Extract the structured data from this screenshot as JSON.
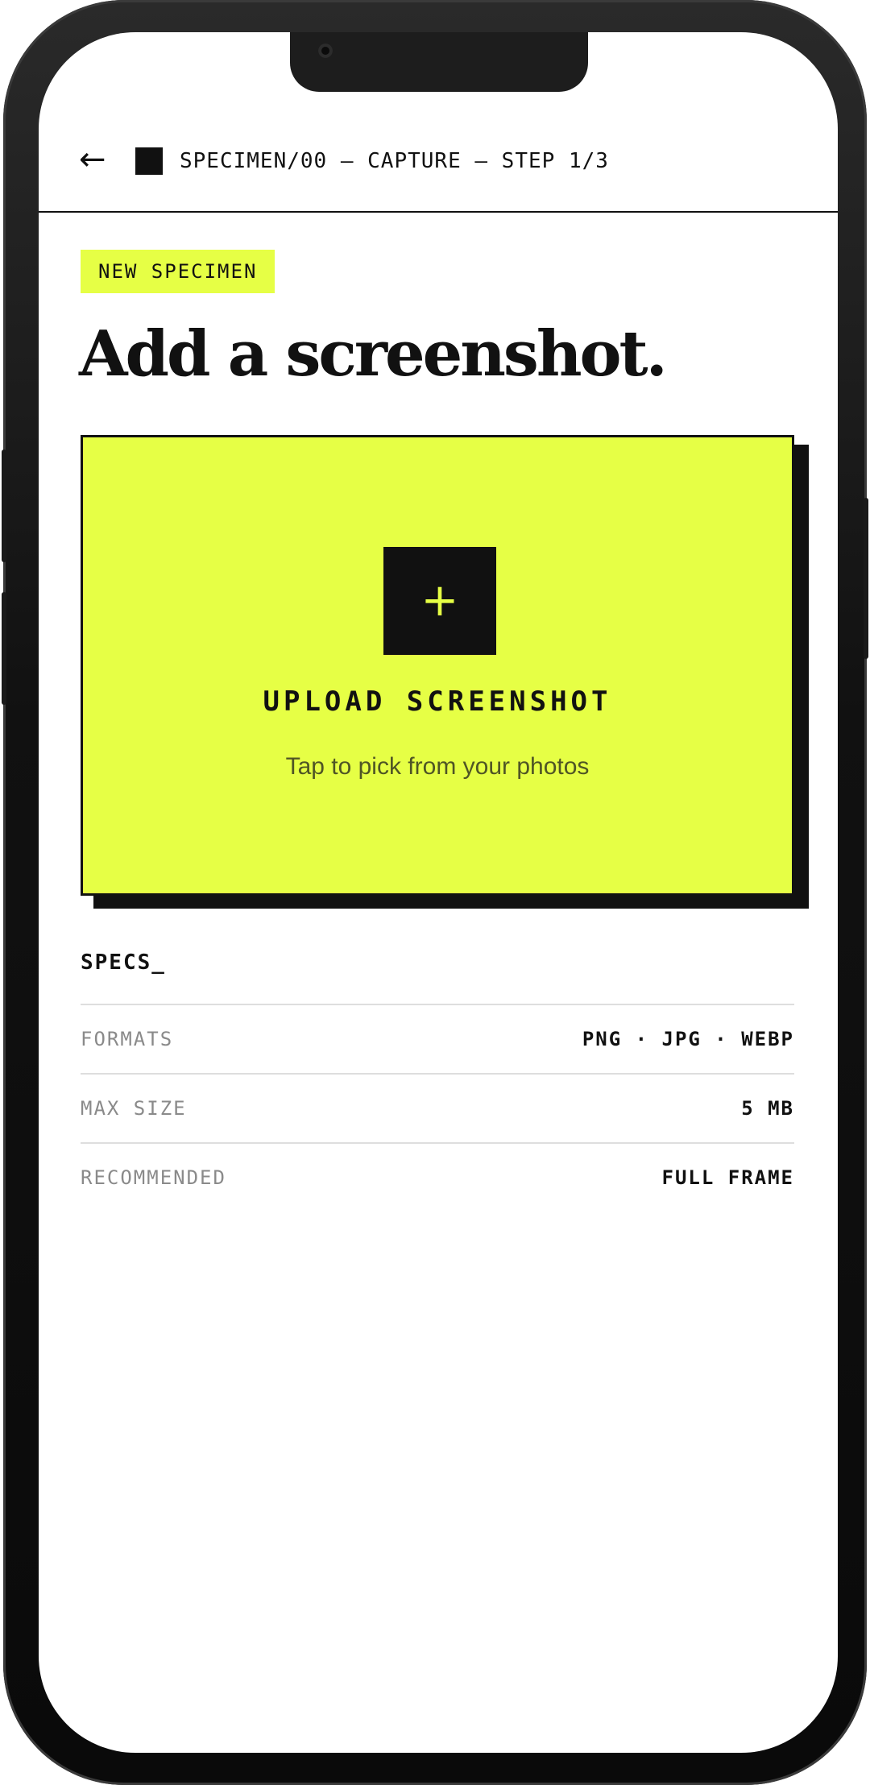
{
  "colors": {
    "accent": "#e6ff45",
    "ink": "#111111",
    "muted": "#8a8a8a",
    "divider": "#dedede"
  },
  "header": {
    "back_icon": "arrow-left-icon",
    "breadcrumb": "SPECIMEN/00 — CAPTURE — STEP 1/3"
  },
  "tag": "NEW SPECIMEN",
  "headline": "Add a screenshot.",
  "upload": {
    "icon": "plus-icon",
    "plus_glyph": "+",
    "title": "UPLOAD SCREENSHOT",
    "subtitle": "Tap to pick from your photos"
  },
  "specs": {
    "heading": "SPECS_",
    "rows": [
      {
        "label": "FORMATS",
        "value": "PNG · JPG · WEBP"
      },
      {
        "label": "MAX SIZE",
        "value": "5 MB"
      },
      {
        "label": "RECOMMENDED",
        "value": "FULL FRAME"
      }
    ]
  }
}
